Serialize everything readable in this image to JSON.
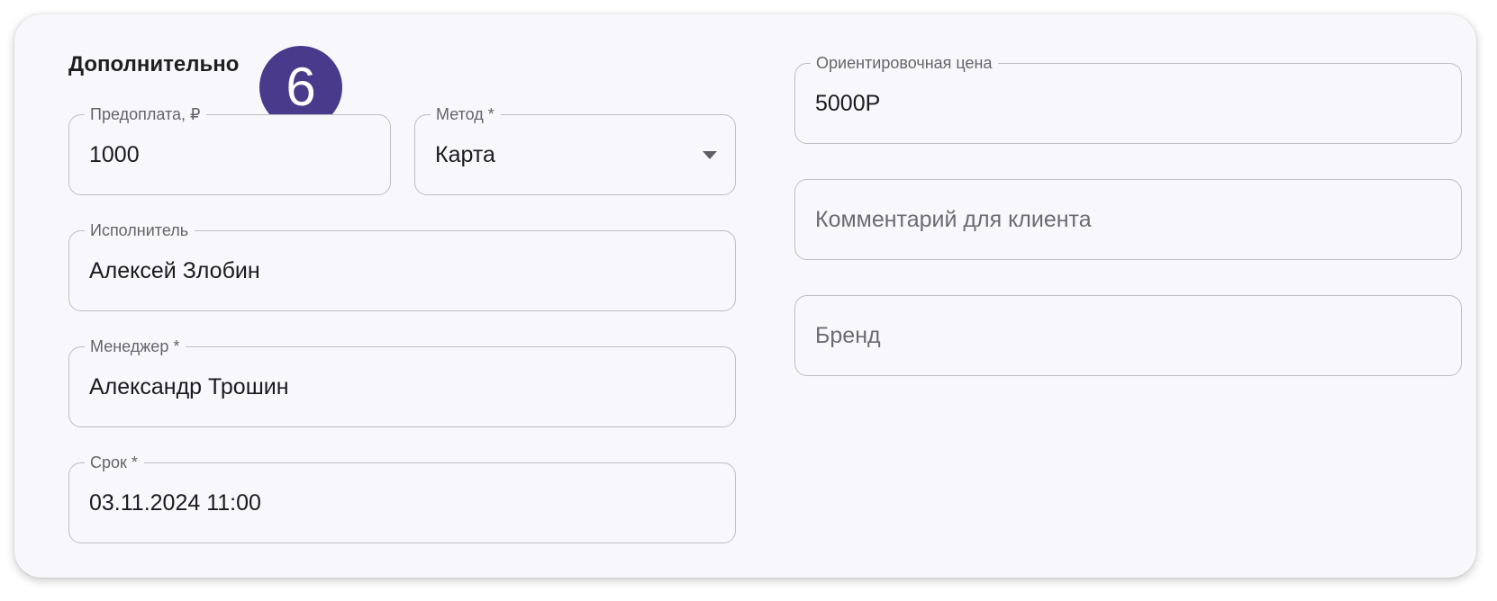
{
  "section": {
    "title": "Дополнительно",
    "step_number": "6"
  },
  "fields": {
    "prepayment": {
      "label": "Предоплата, ₽",
      "value": "1000"
    },
    "method": {
      "label": "Метод *",
      "value": "Карта"
    },
    "executor": {
      "label": "Исполнитель",
      "value": "Алексей Злобин"
    },
    "manager": {
      "label": "Менеджер *",
      "value": "Александр Трошин"
    },
    "deadline": {
      "label": "Срок *",
      "value": "03.11.2024 11:00"
    },
    "estimated_price": {
      "label": "Ориентировочная цена",
      "value": "5000Р"
    },
    "client_comment": {
      "placeholder": "Комментарий для клиента"
    },
    "brand": {
      "placeholder": "Бренд"
    }
  },
  "colors": {
    "badge": "#4a3a8c",
    "card_background": "#f8f8fc",
    "field_border": "#bdbdc3"
  },
  "icons": {
    "method_dropdown": "caret-down-icon"
  }
}
